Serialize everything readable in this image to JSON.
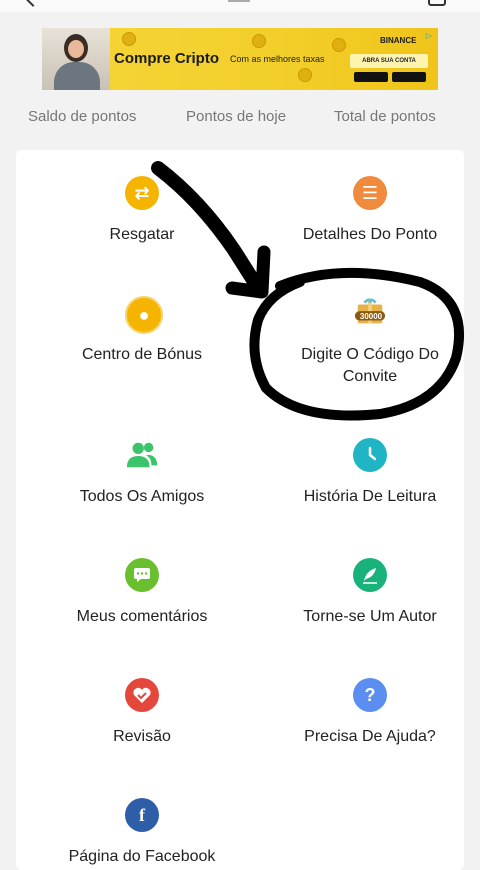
{
  "banner": {
    "title": "Compre Cripto",
    "subtitle": "Com as melhores taxas",
    "brand": "BINANCE",
    "cta": "ABRA SUA CONTA"
  },
  "stats": {
    "balance_label": "Saldo de pontos",
    "today_label": "Pontos de hoje",
    "total_label": "Total de pontos"
  },
  "menu": {
    "items": [
      {
        "label": "Resgatar",
        "icon": "exchange-icon",
        "color": "#f5b400"
      },
      {
        "label": "Detalhes Do Ponto",
        "icon": "coins-stack-icon",
        "color": "#f08a3c"
      },
      {
        "label": "Centro de Bónus",
        "icon": "coin-bag-icon",
        "color": "#f5b400"
      },
      {
        "label": "Digite O Código Do Convite",
        "icon": "gift-box-icon",
        "color": "#c08a20",
        "badge": "30000"
      },
      {
        "label": "Todos Os Amigos",
        "icon": "friends-icon",
        "color": "#3cc46a"
      },
      {
        "label": "História De Leitura",
        "icon": "clock-icon",
        "color": "#20b5c4"
      },
      {
        "label": "Meus comentários",
        "icon": "comment-icon",
        "color": "#6abf2e"
      },
      {
        "label": "Torne-se Um Autor",
        "icon": "quill-icon",
        "color": "#19b27a"
      },
      {
        "label": "Revisão",
        "icon": "heart-check-icon",
        "color": "#e4473c"
      },
      {
        "label": "Precisa De Ajuda?",
        "icon": "help-icon",
        "color": "#5c8ef2"
      },
      {
        "label": "Página do Facebook",
        "icon": "facebook-icon",
        "color": "#2f5ea8"
      }
    ]
  }
}
